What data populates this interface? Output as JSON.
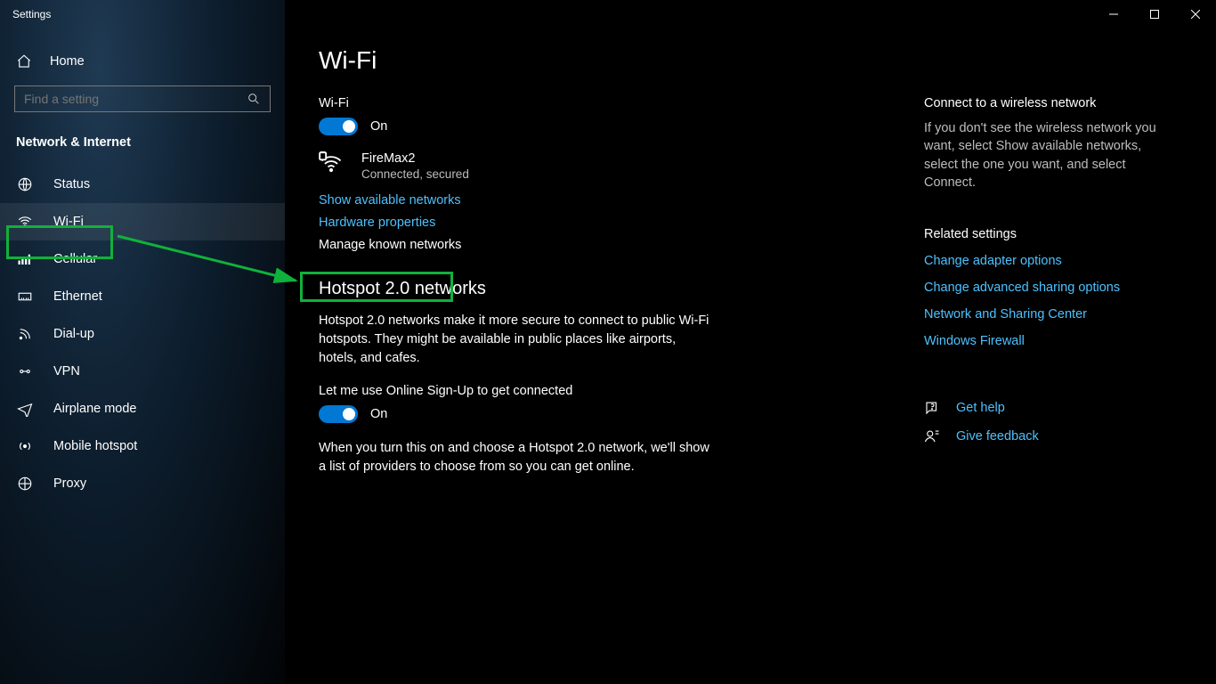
{
  "window": {
    "title": "Settings"
  },
  "sidebar": {
    "home": "Home",
    "search_placeholder": "Find a setting",
    "category": "Network & Internet",
    "items": [
      {
        "label": "Status"
      },
      {
        "label": "Wi-Fi"
      },
      {
        "label": "Cellular"
      },
      {
        "label": "Ethernet"
      },
      {
        "label": "Dial-up"
      },
      {
        "label": "VPN"
      },
      {
        "label": "Airplane mode"
      },
      {
        "label": "Mobile hotspot"
      },
      {
        "label": "Proxy"
      }
    ]
  },
  "main": {
    "title": "Wi-Fi",
    "wifi": {
      "label": "Wi-Fi",
      "state": "On",
      "network_name": "FireMax2",
      "network_status": "Connected, secured"
    },
    "links": {
      "show_available": "Show available networks",
      "hardware": "Hardware properties",
      "manage_known": "Manage known networks"
    },
    "hotspot": {
      "heading": "Hotspot 2.0 networks",
      "desc": "Hotspot 2.0 networks make it more secure to connect to public Wi-Fi hotspots. They might be available in public places like airports, hotels, and cafes.",
      "signup_label": "Let me use Online Sign-Up to get connected",
      "signup_state": "On",
      "signup_desc": "When you turn this on and choose a Hotspot 2.0 network, we'll show a list of providers to choose from so you can get online."
    }
  },
  "aside": {
    "connect_heading": "Connect to a wireless network",
    "connect_body": "If you don't see the wireless network you want, select Show available networks, select the one you want, and select Connect.",
    "related_heading": "Related settings",
    "related": [
      "Change adapter options",
      "Change advanced sharing options",
      "Network and Sharing Center",
      "Windows Firewall"
    ],
    "help": "Get help",
    "feedback": "Give feedback"
  }
}
